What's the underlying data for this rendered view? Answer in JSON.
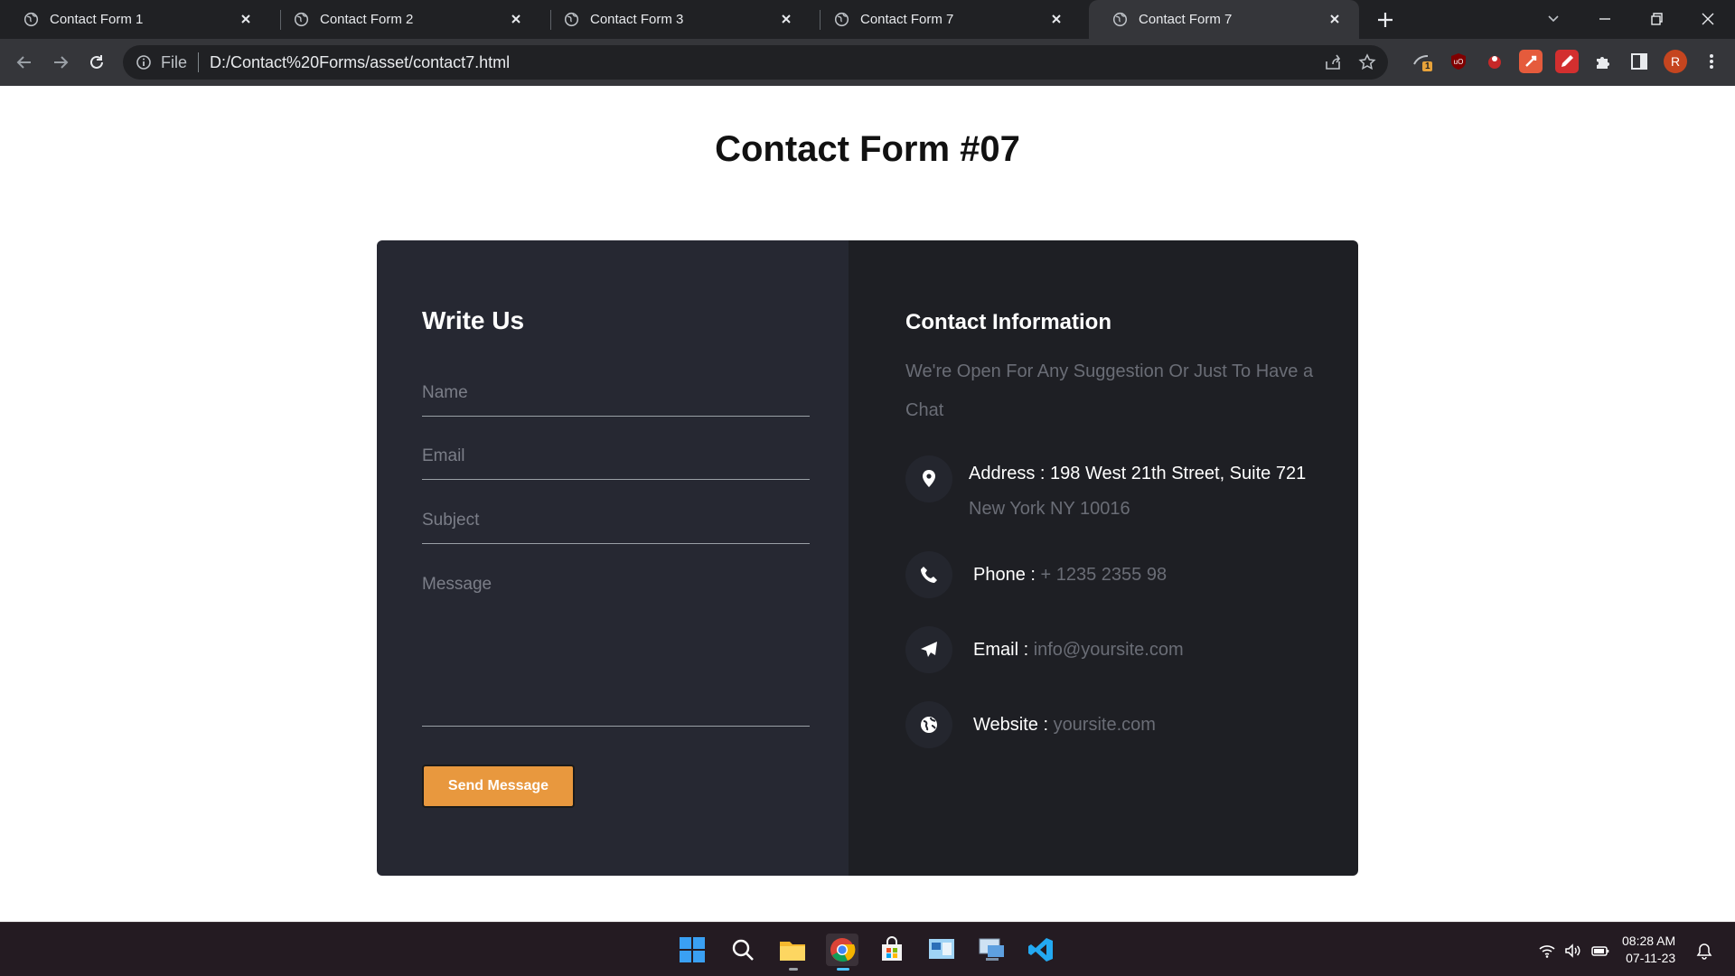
{
  "browser": {
    "tabs": [
      {
        "title": "Contact Form 1",
        "active": false
      },
      {
        "title": "Contact Form 2",
        "active": false
      },
      {
        "title": "Contact Form 3",
        "active": false
      },
      {
        "title": "Contact Form 7",
        "active": false
      },
      {
        "title": "Contact Form 7",
        "active": true
      }
    ],
    "address": {
      "scheme_label": "File",
      "url": "D:/Contact%20Forms/asset/contact7.html"
    },
    "profile_initial": "R",
    "extension_badge": "1"
  },
  "page": {
    "title": "Contact Form #07",
    "form": {
      "heading": "Write Us",
      "name_placeholder": "Name",
      "email_placeholder": "Email",
      "subject_placeholder": "Subject",
      "message_placeholder": "Message",
      "submit_label": "Send Message"
    },
    "info": {
      "heading": "Contact Information",
      "description": "We're Open For Any Suggestion Or Just To Have a Chat",
      "address_label": "Address : ",
      "address_line1": "198 West 21th Street, Suite 721",
      "address_line2": "New York NY 10016",
      "phone_label": "Phone : ",
      "phone_value": "+ 1235 2355 98",
      "email_label": "Email : ",
      "email_value": "info@yoursite.com",
      "website_label": "Website : ",
      "website_value": "yoursite.com"
    },
    "colors": {
      "left_panel": "#262832",
      "right_panel": "#1e1f24",
      "accent": "#e8983e"
    }
  },
  "taskbar": {
    "time": "08:28 AM",
    "date": "07-11-23"
  }
}
